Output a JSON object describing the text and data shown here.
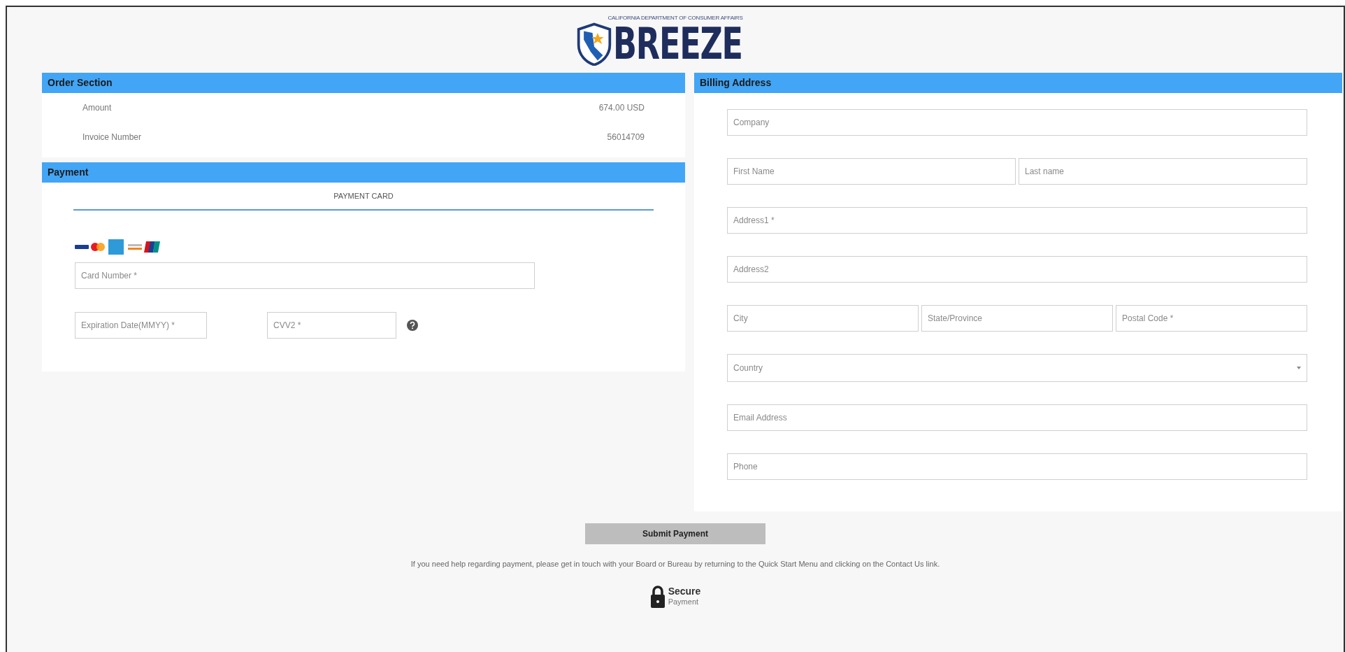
{
  "header": {
    "agency": "CALIFORNIA DEPARTMENT OF CONSUMER AFFAIRS",
    "brand": "BREEZE"
  },
  "order_section": {
    "title": "Order Section",
    "rows": [
      {
        "label": "Amount",
        "value": "674.00 USD"
      },
      {
        "label": "Invoice Number",
        "value": "56014709"
      }
    ]
  },
  "payment": {
    "title": "Payment",
    "tabs": [
      {
        "label": "PAYMENT CARD",
        "selected": true
      }
    ],
    "card_number": {
      "placeholder": "Card Number *"
    },
    "expiration": {
      "placeholder": "Expiration Date(MMYY) *"
    },
    "cvv": {
      "placeholder": "CVV2 *"
    }
  },
  "billing": {
    "title": "Billing Address",
    "rows": [
      [
        {
          "kind": "input",
          "placeholder": "Company"
        }
      ],
      [
        {
          "kind": "input",
          "placeholder": "First Name"
        },
        {
          "kind": "input",
          "placeholder": "Last name"
        }
      ],
      [
        {
          "kind": "input",
          "placeholder": "Address1 *"
        }
      ],
      [
        {
          "kind": "input",
          "placeholder": "Address2"
        }
      ],
      [
        {
          "kind": "input",
          "placeholder": "City"
        },
        {
          "kind": "input",
          "placeholder": "State/Province"
        },
        {
          "kind": "input",
          "placeholder": "Postal Code *"
        }
      ],
      [
        {
          "kind": "select",
          "placeholder": "Country"
        }
      ],
      [
        {
          "kind": "input",
          "placeholder": "Email Address"
        }
      ],
      [
        {
          "kind": "input",
          "placeholder": "Phone"
        }
      ]
    ]
  },
  "submit": {
    "label": "Submit Payment"
  },
  "help_text": "If you need help regarding payment, please get in touch with your Board or Bureau by returning to the Quick Start Menu and clicking on the Contact Us link.",
  "secure": {
    "title": "Secure",
    "subtitle": "Payment"
  }
}
